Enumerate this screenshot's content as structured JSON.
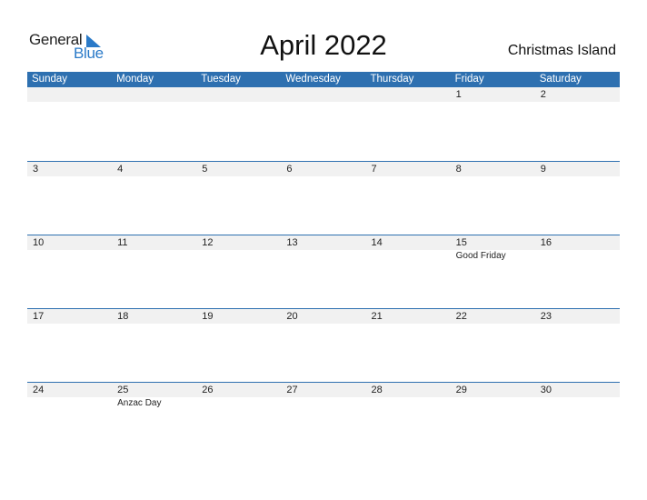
{
  "logo": {
    "general": "General",
    "blue": "Blue"
  },
  "title": "April 2022",
  "country": "Christmas Island",
  "colors": {
    "accent": "#2e70b0",
    "row_bg": "#f1f1f1",
    "logo_blue": "#2a7ac8"
  },
  "weekdays": [
    "Sunday",
    "Monday",
    "Tuesday",
    "Wednesday",
    "Thursday",
    "Friday",
    "Saturday"
  ],
  "weeks": [
    {
      "days": [
        "",
        "",
        "",
        "",
        "",
        "1",
        "2"
      ],
      "events": [
        "",
        "",
        "",
        "",
        "",
        "",
        ""
      ]
    },
    {
      "days": [
        "3",
        "4",
        "5",
        "6",
        "7",
        "8",
        "9"
      ],
      "events": [
        "",
        "",
        "",
        "",
        "",
        "",
        ""
      ]
    },
    {
      "days": [
        "10",
        "11",
        "12",
        "13",
        "14",
        "15",
        "16"
      ],
      "events": [
        "",
        "",
        "",
        "",
        "",
        "Good Friday",
        ""
      ]
    },
    {
      "days": [
        "17",
        "18",
        "19",
        "20",
        "21",
        "22",
        "23"
      ],
      "events": [
        "",
        "",
        "",
        "",
        "",
        "",
        ""
      ]
    },
    {
      "days": [
        "24",
        "25",
        "26",
        "27",
        "28",
        "29",
        "30"
      ],
      "events": [
        "",
        "Anzac Day",
        "",
        "",
        "",
        "",
        ""
      ]
    }
  ]
}
